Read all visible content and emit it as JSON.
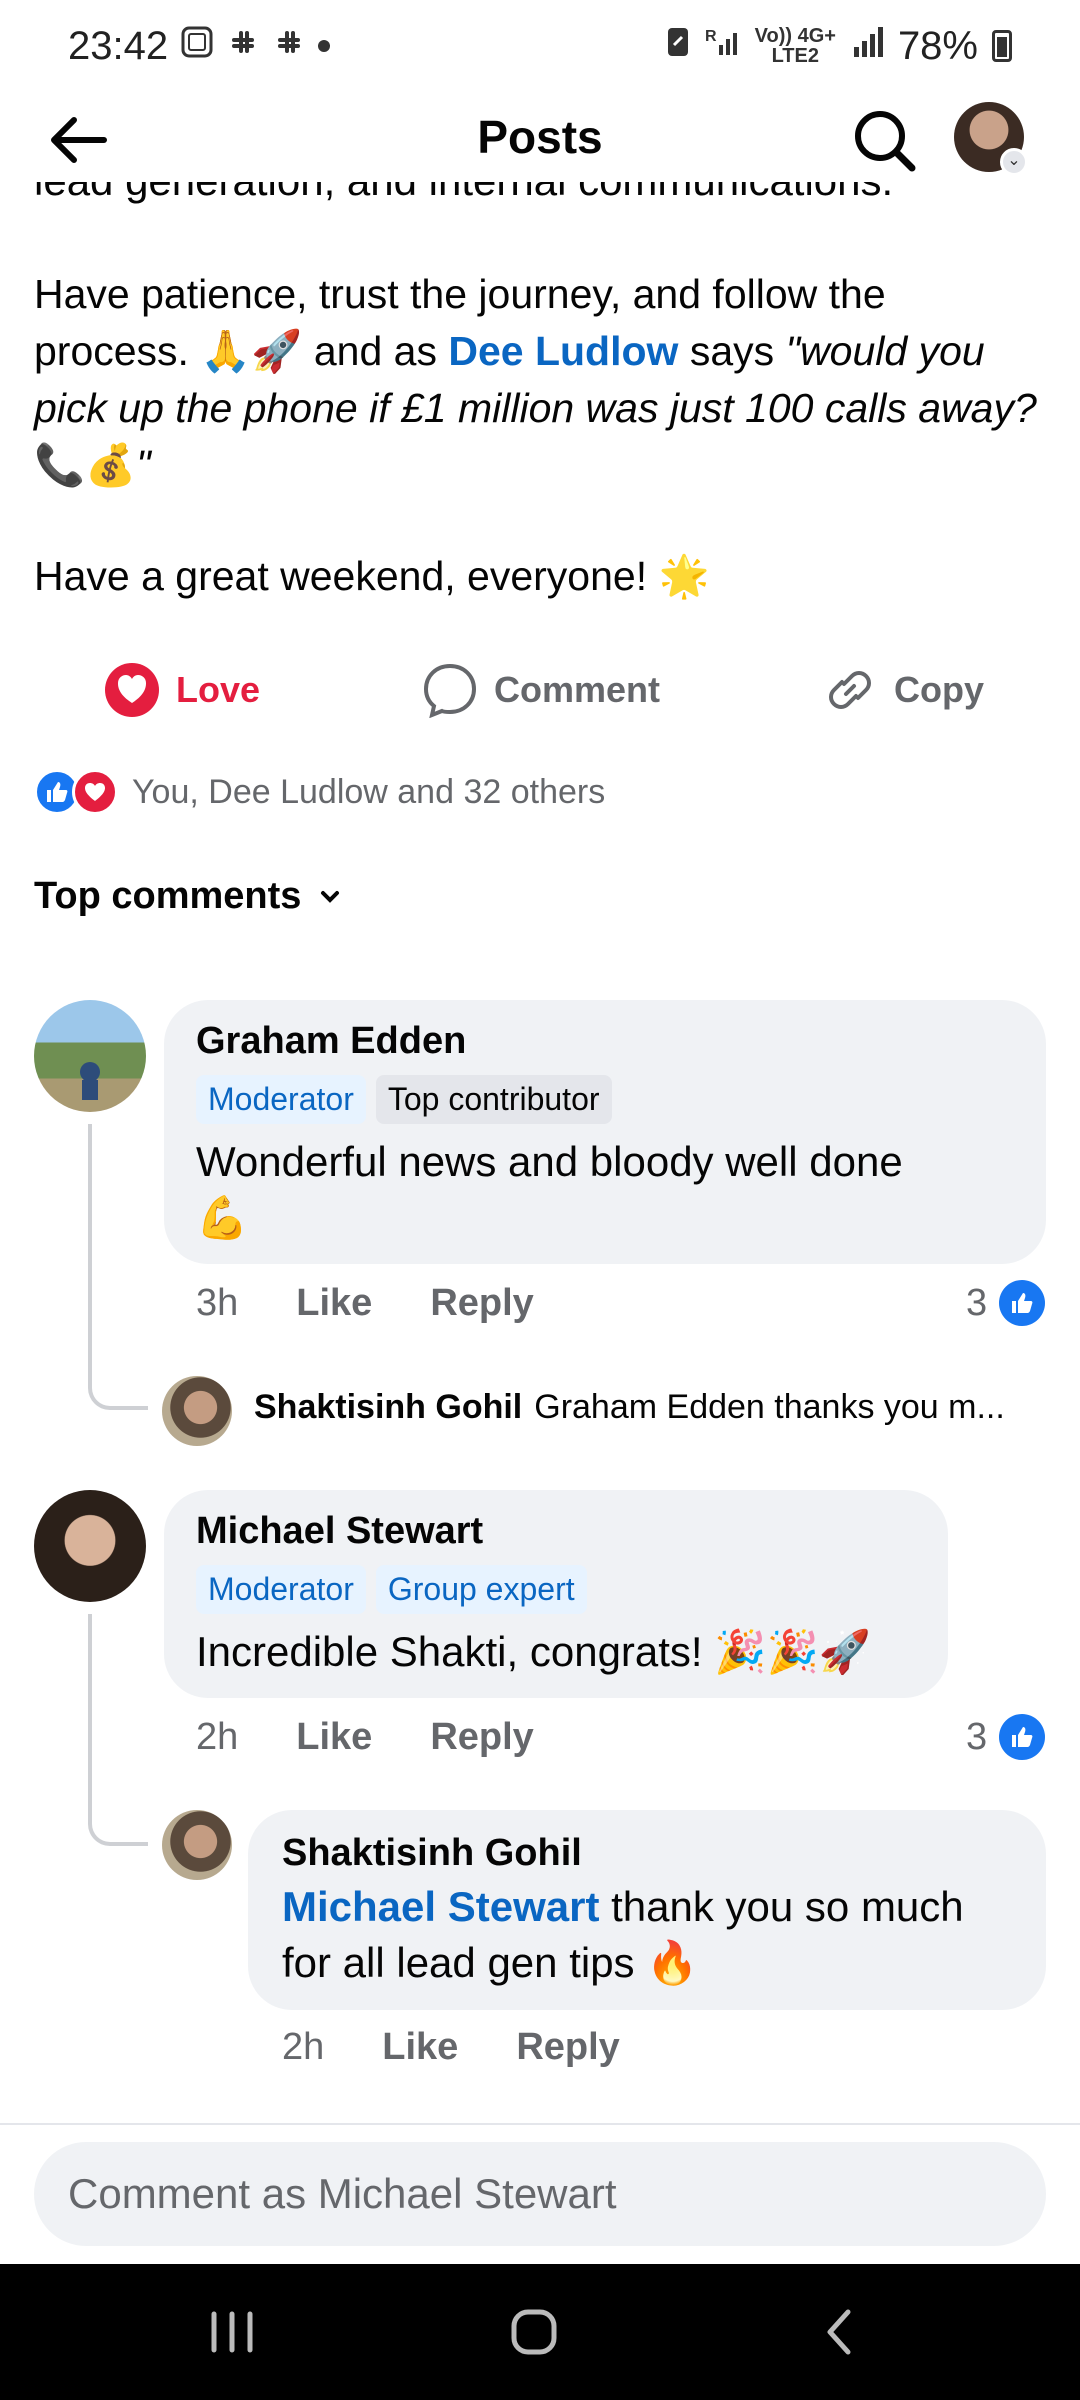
{
  "status_bar": {
    "time": "23:42",
    "carrier_label_top": "Vo)) 4G+",
    "carrier_label_bottom": "LTE2",
    "battery": "78%"
  },
  "header": {
    "title": "Posts"
  },
  "post": {
    "cut_line": "lead generation, and internal communications.",
    "para1_a": "Have patience, trust the journey, and follow the process. ",
    "para1_emoji": "🙏🚀",
    "para1_b": " and as ",
    "para1_mention": "Dee Ludlow",
    "para1_c": " says ",
    "para1_quote": "\"would you pick up the phone if £1 million was just 100 calls away? ",
    "para1_quote_emoji": "📞💰",
    "para1_quote_end": "\"",
    "para2": "Have a great weekend, everyone! ",
    "para2_emoji": "🌟"
  },
  "actions": {
    "love": "Love",
    "comment": "Comment",
    "copy": "Copy"
  },
  "reactions": {
    "summary": "You, Dee Ludlow and 32 others"
  },
  "top_comments_label": "Top comments",
  "comments": [
    {
      "name": "Graham Edden",
      "badges": [
        "Moderator",
        "Top contributor"
      ],
      "text": "Wonderful news and bloody well done",
      "emoji": "💪",
      "time": "3h",
      "like": "Like",
      "reply": "Reply",
      "likes": "3",
      "reply_preview": {
        "name": "Shaktisinh Gohil",
        "text": "Graham Edden thanks you m..."
      }
    },
    {
      "name": "Michael Stewart",
      "badges": [
        "Moderator",
        "Group expert"
      ],
      "text": "Incredible Shakti, congrats! ",
      "emoji": "🎉🎉🚀",
      "time": "2h",
      "like": "Like",
      "reply": "Reply",
      "likes": "3"
    }
  ],
  "reply": {
    "name": "Shaktisinh Gohil",
    "mention": "Michael Stewart",
    "text": " thank you so much for all lead gen tips ",
    "emoji": "🔥",
    "time": "2h",
    "like": "Like",
    "reply": "Reply"
  },
  "composer": {
    "placeholder": "Comment as Michael Stewart"
  },
  "colors": {
    "accent": "#0a66c2",
    "love": "#e41e3f",
    "like": "#1877f2",
    "bubble": "#f0f2f5"
  }
}
